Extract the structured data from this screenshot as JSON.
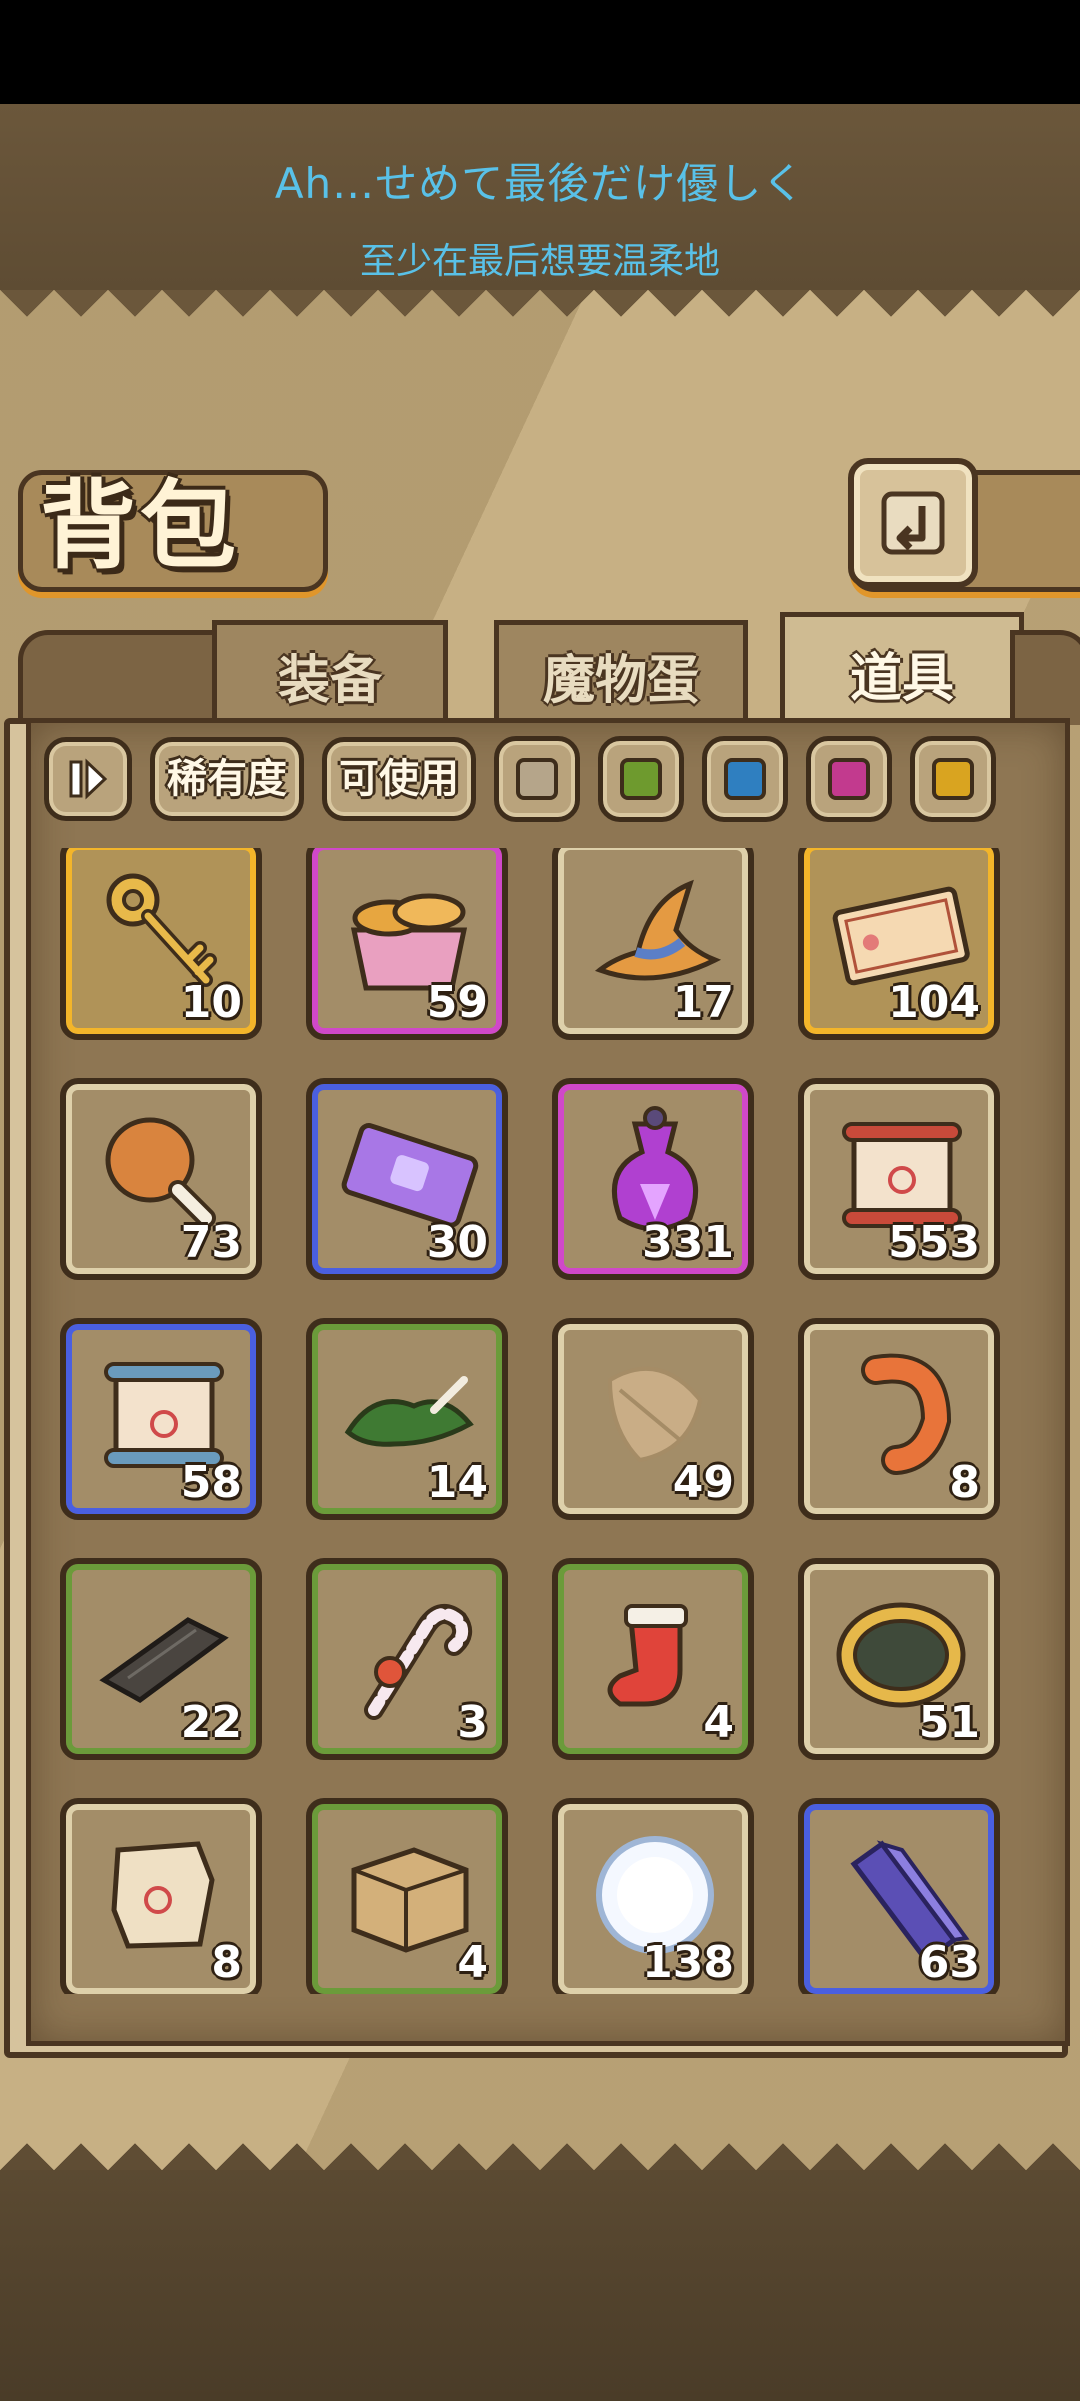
{
  "subtitle": {
    "jp": "Ah…せめて最後だけ優しく",
    "cn": "至少在最后想要温柔地"
  },
  "header": {
    "title": "背包",
    "back_icon": "return-arrow-icon"
  },
  "tabs": [
    {
      "label": "装备",
      "active": false
    },
    {
      "label": "魔物蛋",
      "active": false
    },
    {
      "label": "道具",
      "active": true
    }
  ],
  "filters": {
    "sort_icon": "sort-toggle-icon",
    "rarity_label": "稀有度",
    "usable_label": "可使用",
    "rarity_colors": [
      "#b5a58a",
      "#6e9a2e",
      "#2f7fc0",
      "#c23a8e",
      "#d9a420"
    ]
  },
  "items": [
    {
      "icon": "golden-key-icon",
      "count": "10",
      "rarity": "gold"
    },
    {
      "icon": "bread-basket-icon",
      "count": "59",
      "rarity": "purple"
    },
    {
      "icon": "wizard-hat-icon",
      "count": "17",
      "rarity": "white"
    },
    {
      "icon": "ticket-card-icon",
      "count": "104",
      "rarity": "gold"
    },
    {
      "icon": "chicken-leg-icon",
      "count": "73",
      "rarity": "white"
    },
    {
      "icon": "purple-ticket-icon",
      "count": "30",
      "rarity": "blue"
    },
    {
      "icon": "potion-flask-icon",
      "count": "331",
      "rarity": "purple"
    },
    {
      "icon": "red-scroll-icon",
      "count": "553",
      "rarity": "white"
    },
    {
      "icon": "blue-scroll-icon",
      "count": "58",
      "rarity": "blue"
    },
    {
      "icon": "herb-bundle-icon",
      "count": "14",
      "rarity": "green"
    },
    {
      "icon": "feather-icon",
      "count": "49",
      "rarity": "white"
    },
    {
      "icon": "shrimp-icon",
      "count": "8",
      "rarity": "white"
    },
    {
      "icon": "wood-plank-icon",
      "count": "22",
      "rarity": "green"
    },
    {
      "icon": "candy-cane-icon",
      "count": "3",
      "rarity": "green"
    },
    {
      "icon": "christmas-stocking-icon",
      "count": "4",
      "rarity": "green"
    },
    {
      "icon": "pie-icon",
      "count": "51",
      "rarity": "white"
    },
    {
      "icon": "torn-paper-icon",
      "count": "8",
      "rarity": "white"
    },
    {
      "icon": "wooden-crate-icon",
      "count": "4",
      "rarity": "green"
    },
    {
      "icon": "snowball-icon",
      "count": "138",
      "rarity": "white"
    },
    {
      "icon": "crystal-bar-icon",
      "count": "63",
      "rarity": "blue"
    }
  ]
}
